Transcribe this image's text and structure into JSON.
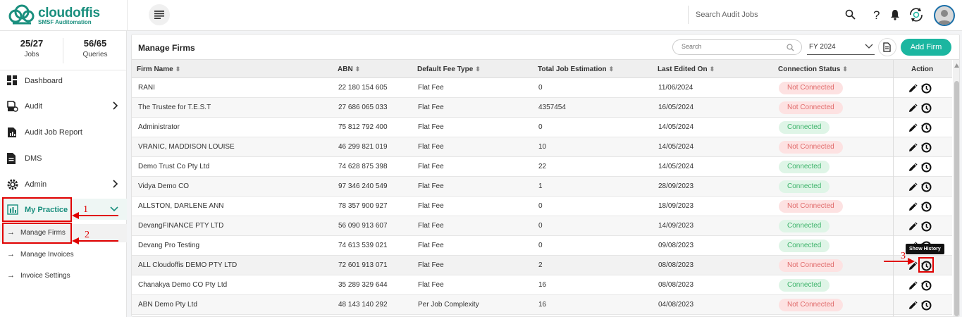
{
  "brand": {
    "name": "cloudoffis",
    "tagline": "SMSF Auditomation"
  },
  "header": {
    "search_placeholder": "Search Audit Jobs"
  },
  "stats": [
    {
      "value": "25/27",
      "label": "Jobs"
    },
    {
      "value": "56/65",
      "label": "Queries"
    }
  ],
  "nav": {
    "dashboard": "Dashboard",
    "audit": "Audit",
    "audit_job_report": "Audit Job Report",
    "dms": "DMS",
    "admin": "Admin",
    "my_practice": "My Practice",
    "manage_firms": "Manage Firms",
    "manage_invoices": "Manage Invoices",
    "invoice_settings": "Invoice Settings"
  },
  "annotations": {
    "one": "1",
    "two": "2",
    "three": "3"
  },
  "page": {
    "title": "Manage Firms",
    "search_placeholder": "Search",
    "fy_value": "FY 2024",
    "add_label": "Add Firm",
    "tooltip": "Show History"
  },
  "columns": {
    "firm_name": "Firm Name",
    "abn": "ABN",
    "fee_type": "Default Fee Type",
    "estimation": "Total Job Estimation",
    "edited": "Last Edited On",
    "status": "Connection Status",
    "action": "Action"
  },
  "rows": [
    {
      "firm": "RANI",
      "abn": "22 180 154 605",
      "fee": "Flat Fee",
      "est": "0",
      "date": "11/06/2024",
      "status": "Not Connected",
      "connected": false
    },
    {
      "firm": "The Trustee for T.E.S.T",
      "abn": "27 686 065 033",
      "fee": "Flat Fee",
      "est": "4357454",
      "date": "16/05/2024",
      "status": "Not Connected",
      "connected": false
    },
    {
      "firm": "Administrator",
      "abn": "75 812 792 400",
      "fee": "Flat Fee",
      "est": "0",
      "date": "14/05/2024",
      "status": "Connected",
      "connected": true
    },
    {
      "firm": "VRANIC, MADDISON LOUISE",
      "abn": "46 299 821 019",
      "fee": "Flat Fee",
      "est": "10",
      "date": "14/05/2024",
      "status": "Not Connected",
      "connected": false
    },
    {
      "firm": "Demo Trust Co Pty Ltd",
      "abn": "74 628 875 398",
      "fee": "Flat Fee",
      "est": "22",
      "date": "14/05/2024",
      "status": "Connected",
      "connected": true
    },
    {
      "firm": "Vidya Demo CO",
      "abn": "97 346 240 549",
      "fee": "Flat Fee",
      "est": "1",
      "date": "28/09/2023",
      "status": "Connected",
      "connected": true
    },
    {
      "firm": "ALLSTON, DARLENE ANN",
      "abn": "78 357 900 927",
      "fee": "Flat Fee",
      "est": "0",
      "date": "18/09/2023",
      "status": "Not Connected",
      "connected": false
    },
    {
      "firm": "DevangFINANCE PTY LTD",
      "abn": "56 090 913 607",
      "fee": "Flat Fee",
      "est": "0",
      "date": "14/09/2023",
      "status": "Connected",
      "connected": true
    },
    {
      "firm": "Devang Pro Testing",
      "abn": "74 613 539 021",
      "fee": "Flat Fee",
      "est": "0",
      "date": "09/08/2023",
      "status": "Connected",
      "connected": true
    },
    {
      "firm": "ALL Cloudoffis DEMO PTY LTD",
      "abn": "72 601 913 071",
      "fee": "Flat Fee",
      "est": "2",
      "date": "08/08/2023",
      "status": "Not Connected",
      "connected": false
    },
    {
      "firm": "Chanakya Demo CO Pty Ltd",
      "abn": "35 289 329 644",
      "fee": "Flat Fee",
      "est": "16",
      "date": "08/08/2023",
      "status": "Connected",
      "connected": true
    },
    {
      "firm": "ABN Demo Pty Ltd",
      "abn": "48 143 140 292",
      "fee": "Per Job Complexity",
      "est": "16",
      "date": "04/08/2023",
      "status": "Not Connected",
      "connected": false
    }
  ],
  "colors": {
    "accent": "#1bb6a0",
    "brand": "#1a8f7e",
    "annotation": "#e00000"
  }
}
